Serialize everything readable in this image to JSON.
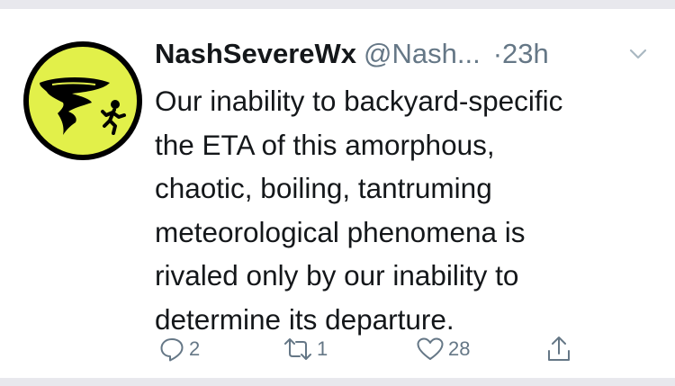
{
  "tweet": {
    "display_name": "NashSevereWx",
    "handle": "@Nash...",
    "separator": "·",
    "time": "23h",
    "text_lines": [
      "Our inability to backyard-specific",
      "the ETA of this amorphous,",
      "chaotic, boiling, tantruming",
      "meteorological phenomena is",
      "rivaled only by our inability to",
      "determine its departure."
    ],
    "avatar": {
      "icon": "tornado-running-person-icon",
      "bg_color": "#e2f04a",
      "ring_color": "#000000"
    },
    "actions": {
      "reply_count": "2",
      "retweet_count": "1",
      "like_count": "28"
    }
  },
  "colors": {
    "text": "#14171a",
    "secondary": "#657786",
    "divider": "#e8e8ed"
  }
}
